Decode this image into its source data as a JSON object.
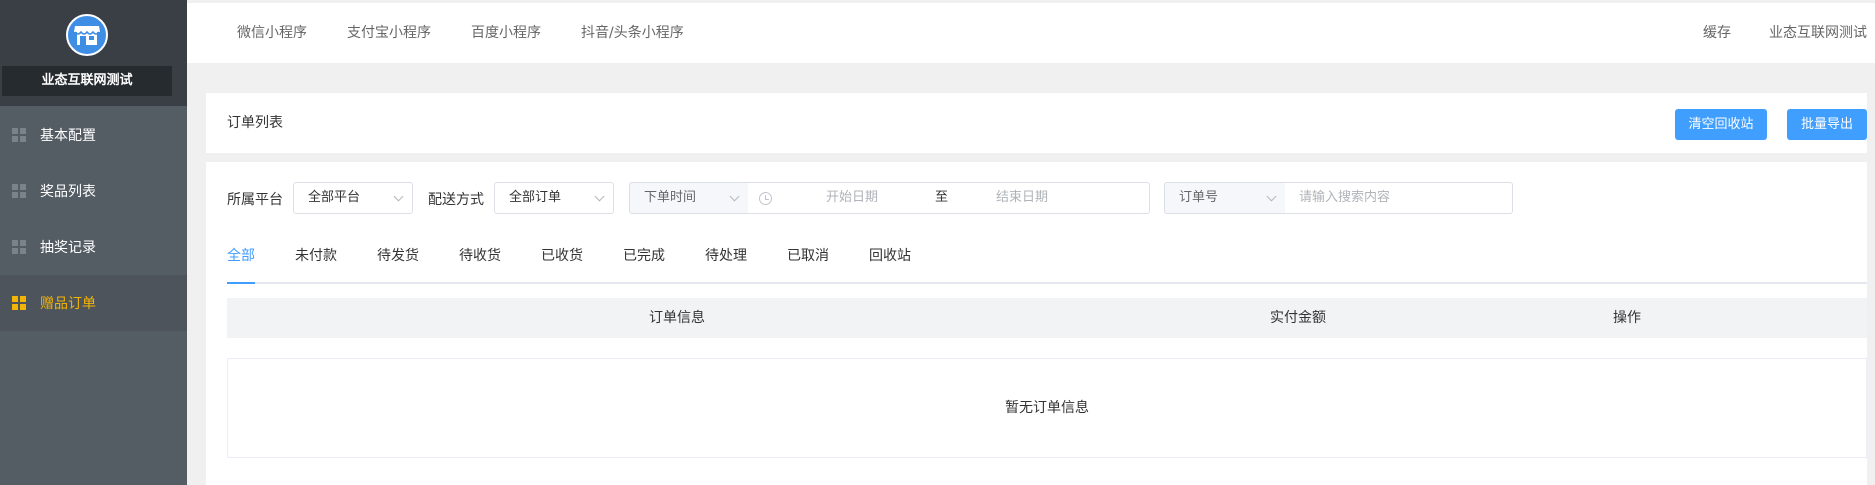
{
  "sidebar": {
    "shop_name": "业态互联网测试",
    "items": [
      {
        "label": "基本配置",
        "active": false
      },
      {
        "label": "奖品列表",
        "active": false
      },
      {
        "label": "抽奖记录",
        "active": false
      },
      {
        "label": "赠品订单",
        "active": true
      }
    ]
  },
  "topbar": {
    "tabs": [
      "微信小程序",
      "支付宝小程序",
      "百度小程序",
      "抖音/头条小程序"
    ],
    "cache": "缓存",
    "account": "业态互联网测试"
  },
  "header": {
    "title": "订单列表",
    "clear_recycle": "清空回收站",
    "batch_export": "批量导出"
  },
  "filters": {
    "platform_label": "所属平台",
    "platform_value": "全部平台",
    "delivery_label": "配送方式",
    "delivery_value": "全部订单",
    "time_type": "下单时间",
    "start_placeholder": "开始日期",
    "range_separator": "至",
    "end_placeholder": "结束日期",
    "search_type": "订单号",
    "search_placeholder": "请输入搜索内容"
  },
  "status_tabs": [
    "全部",
    "未付款",
    "待发货",
    "待收货",
    "已收货",
    "已完成",
    "待处理",
    "已取消",
    "回收站"
  ],
  "table": {
    "columns": [
      "订单信息",
      "实付金额",
      "操作"
    ],
    "empty_text": "暂无订单信息"
  },
  "colors": {
    "accent": "#409eff",
    "sidebar_bg": "#545c64",
    "active_menu": "#f5b400"
  }
}
